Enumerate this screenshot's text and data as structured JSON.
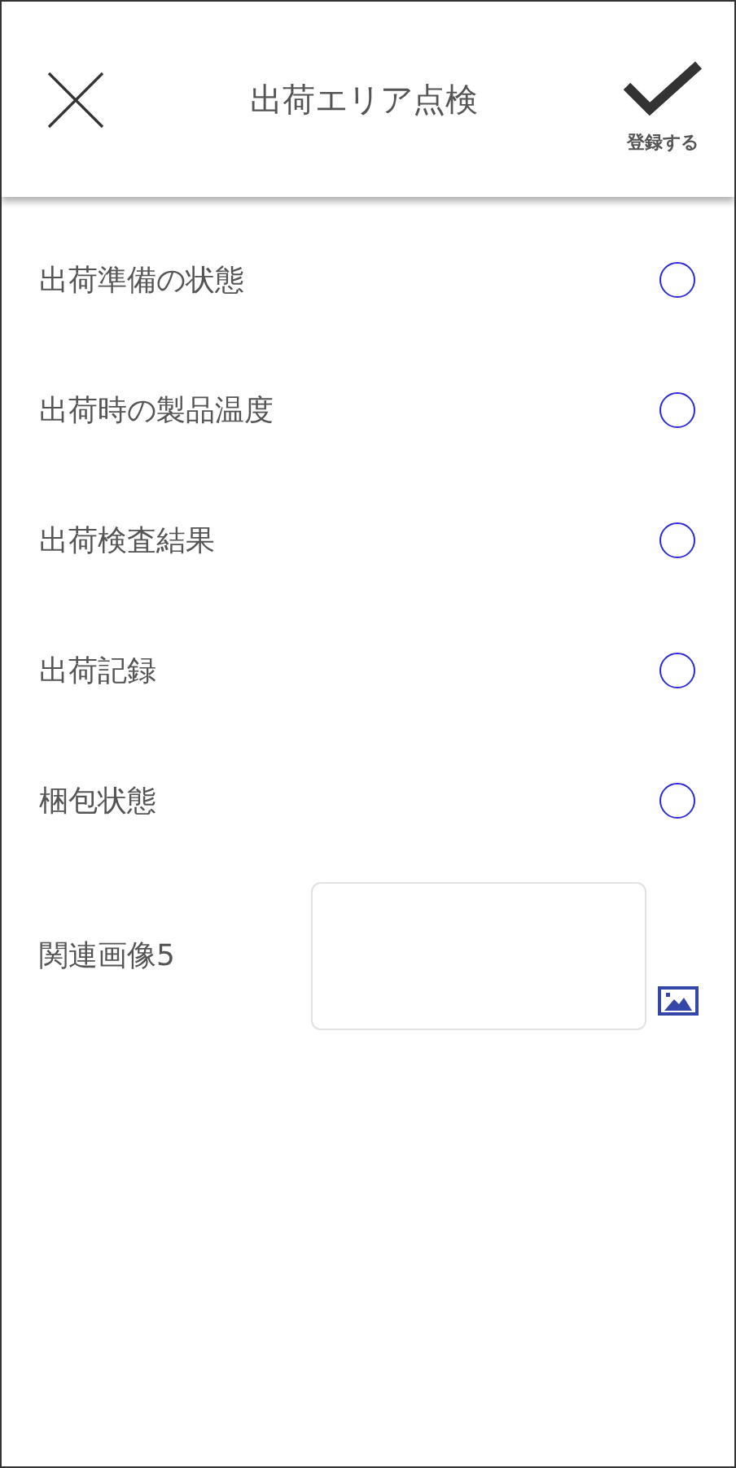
{
  "header": {
    "title": "出荷エリア点検",
    "save_label": "登録する"
  },
  "items": [
    {
      "kind": "radio",
      "label": "出荷準備の状態",
      "selected": false
    },
    {
      "kind": "radio",
      "label": "出荷時の製品温度",
      "selected": false
    },
    {
      "kind": "radio",
      "label": "出荷検査結果",
      "selected": false
    },
    {
      "kind": "radio",
      "label": "出荷記録",
      "selected": false
    },
    {
      "kind": "radio",
      "label": "梱包状態",
      "selected": false
    },
    {
      "kind": "image",
      "label": "関連画像5"
    }
  ]
}
